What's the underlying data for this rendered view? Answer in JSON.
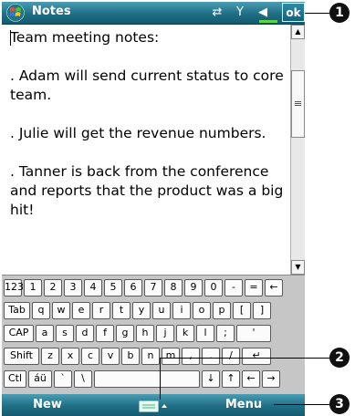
{
  "window": {
    "title": "Notes",
    "ok_label": "ok"
  },
  "titlebar_icons": [
    "start-flag-icon",
    "connectivity-icon",
    "signal-icon",
    "volume-icon"
  ],
  "note": {
    "lines": [
      "Team meeting notes:",
      ". Adam will send current  status to core team.",
      ". Julie will get the revenue numbers.",
      ". Tanner is back from the conference and reports that the product was a big hit!"
    ]
  },
  "keyboard": {
    "row1": [
      "123",
      "1",
      "2",
      "3",
      "4",
      "5",
      "6",
      "7",
      "8",
      "9",
      "0",
      "-",
      "=",
      "←"
    ],
    "row2": [
      "Tab",
      "q",
      "w",
      "e",
      "r",
      "t",
      "y",
      "u",
      "i",
      "o",
      "p",
      "[",
      "]"
    ],
    "row3": [
      "CAP",
      "a",
      "s",
      "d",
      "f",
      "g",
      "h",
      "j",
      "k",
      "l",
      ";",
      "'"
    ],
    "row4": [
      "Shift",
      "z",
      "x",
      "c",
      "v",
      "b",
      "n",
      "m",
      ",",
      ".",
      "/",
      "↵"
    ],
    "row5": [
      "Ctl",
      "áü",
      "`",
      "\\",
      "",
      "↓",
      "↑",
      "←",
      "→"
    ]
  },
  "menubar": {
    "left": "New",
    "right": "Menu"
  },
  "callouts": [
    "1",
    "2",
    "3"
  ],
  "colors": {
    "titlebar": "#1f6e85",
    "keyboard_bg": "#c6c6c6",
    "signal": "#5fd24a"
  }
}
